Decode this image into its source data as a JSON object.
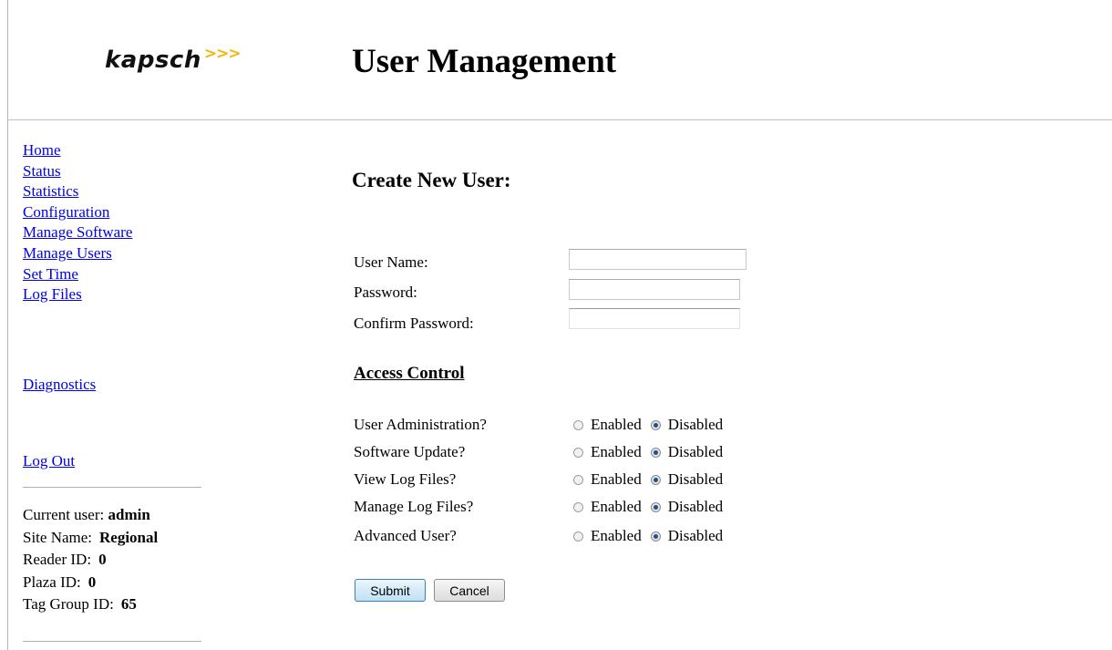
{
  "header": {
    "logo_text": "kapsch",
    "logo_arrows": ">>>",
    "title": "User Management"
  },
  "nav": {
    "items": [
      "Home",
      "Status",
      "Statistics",
      "Configuration",
      "Manage Software",
      "Manage Users",
      "Set Time",
      "Log Files"
    ],
    "diagnostics": "Diagnostics",
    "logout": "Log Out"
  },
  "info": {
    "current_user_label": "Current user:",
    "current_user": "admin",
    "site_name_label": "Site Name:",
    "site_name": "Regional",
    "reader_id_label": "Reader ID:",
    "reader_id": "0",
    "plaza_id_label": "Plaza ID:",
    "plaza_id": "0",
    "tag_group_id_label": "Tag Group ID:",
    "tag_group_id": "65"
  },
  "form": {
    "title": "Create New User:",
    "username_label": "User Name:",
    "username_value": "",
    "password_label": "Password:",
    "password_value": "",
    "confirm_label": "Confirm Password:",
    "confirm_value": ""
  },
  "access": {
    "title": "Access Control",
    "enabled_label": "Enabled",
    "disabled_label": "Disabled",
    "permissions": [
      {
        "label": "User Administration?",
        "selected": "Disabled"
      },
      {
        "label": "Software Update?",
        "selected": "Disabled"
      },
      {
        "label": "View Log Files?",
        "selected": "Disabled"
      },
      {
        "label": "Manage Log Files?",
        "selected": "Disabled"
      },
      {
        "label": "Advanced User?",
        "selected": "Disabled"
      }
    ]
  },
  "buttons": {
    "submit": "Submit",
    "cancel": "Cancel"
  },
  "colors": {
    "link": "#0000ee",
    "logo_arrows": "#f2b705",
    "radio_selected": "#1f4f8f"
  }
}
